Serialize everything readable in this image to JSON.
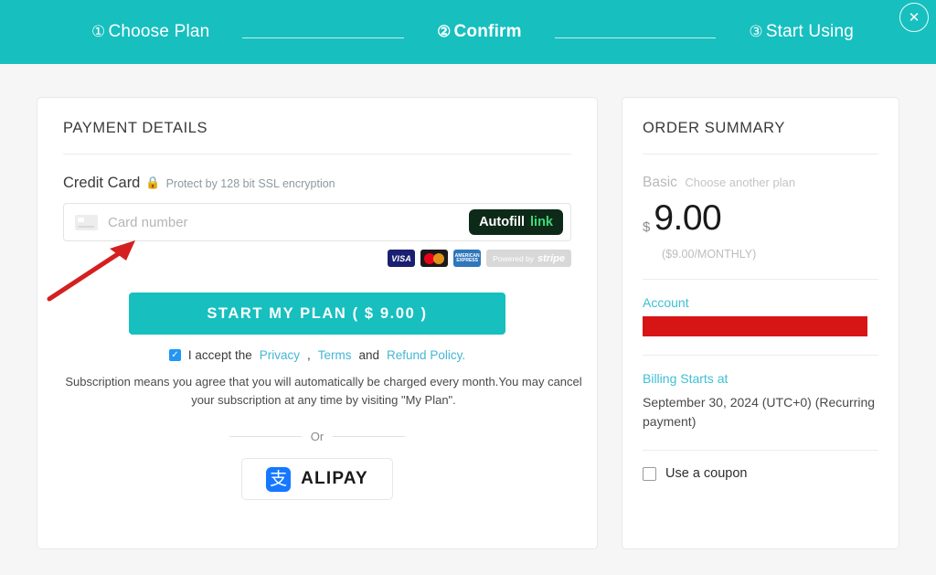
{
  "header": {
    "steps": [
      {
        "num": "①",
        "label": "Choose Plan",
        "active": false
      },
      {
        "num": "②",
        "label": "Confirm",
        "active": true
      },
      {
        "num": "③",
        "label": "Start Using",
        "active": false
      }
    ],
    "close_label": "✕",
    "background_color": "#17bfbf"
  },
  "payment": {
    "title": "PAYMENT DETAILS",
    "credit_card_label": "Credit Card",
    "lock_icon": "lock-icon",
    "ssl_note": "Protect by 128 bit SSL encryption",
    "card_input_placeholder": "Card number",
    "card_input_value": "",
    "autofill": {
      "word": "Autofill",
      "link_word": "link"
    },
    "brands": [
      {
        "name": "visa",
        "label": "VISA"
      },
      {
        "name": "mastercard",
        "label": ""
      },
      {
        "name": "amex",
        "label": "AMERICAN EXPRESS"
      }
    ],
    "stripe_badge": {
      "prefix": "Powered by",
      "word": "stripe"
    },
    "cta_label": "START MY PLAN ( $ 9.00 )",
    "accept": {
      "checked": true,
      "prefix": "I accept the",
      "privacy": "Privacy",
      "comma": ",",
      "terms": "Terms",
      "and": "and",
      "refund": "Refund Policy."
    },
    "subscription_note": "Subscription means you agree that you will automatically be charged every month.You may cancel your subscription at any time by visiting \"My Plan\".",
    "or_text": "Or",
    "alipay": {
      "glyph": "支",
      "label": "ALIPAY"
    }
  },
  "summary": {
    "title": "ORDER SUMMARY",
    "plan_name": "Basic",
    "plan_change_link": "Choose another plan",
    "currency": "$",
    "price": "9.00",
    "price_period": "($9.00/MONTHLY)",
    "account_label": "Account",
    "account_value_redacted": true,
    "billing_label": "Billing Starts at",
    "billing_value": "September 30, 2024 (UTC+0) (Recurring payment)",
    "coupon_label": "Use a coupon",
    "coupon_checked": false
  },
  "annotation": {
    "arrow_color": "#d42020",
    "description": "red-arrow-pointing-to-card-input"
  }
}
